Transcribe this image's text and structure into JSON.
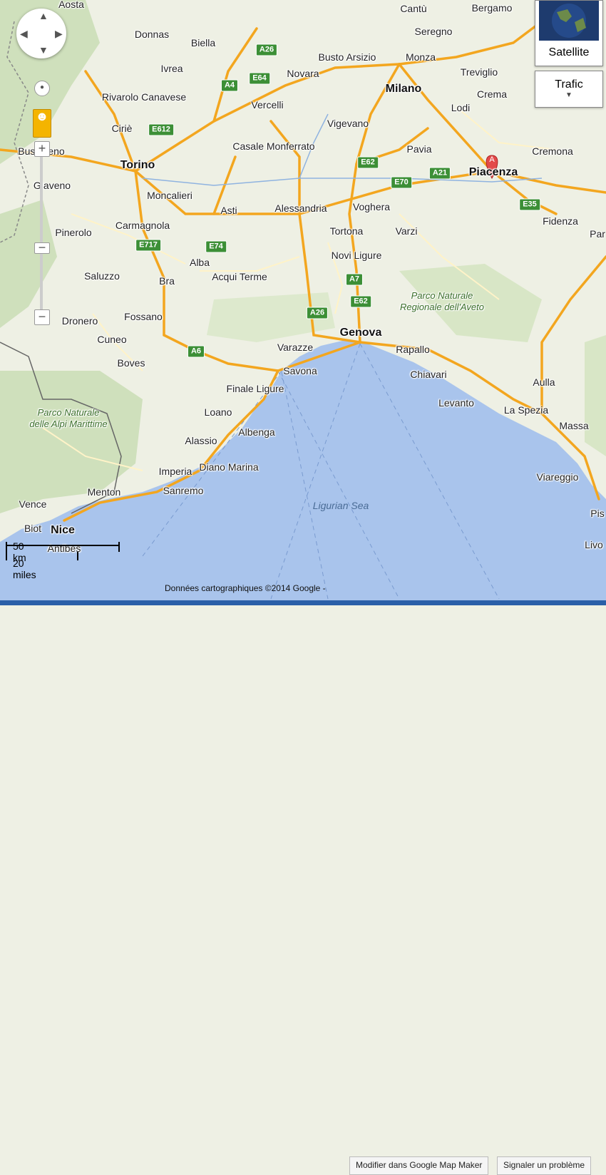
{
  "map_type_controls": {
    "satellite": "Satellite",
    "traffic": "Trafic"
  },
  "attribution": "Données cartographiques ©2014 Google -",
  "footer_links": [
    "Modifier dans Google Map Maker",
    "Signaler un problème"
  ],
  "scale": {
    "km": "50 km",
    "miles": "20 miles"
  },
  "marker": {
    "letter": "A"
  },
  "sea_label": "Ligurian Sea",
  "parks": [
    "Parco Naturale delle Alpi Marittime",
    "Parco Naturale Regionale dell'Aveto"
  ],
  "cities_major": [
    "Torino",
    "Milano",
    "Genova",
    "Nice",
    "Piacenza"
  ],
  "cities": [
    "Aosta",
    "Bergamo",
    "Cantù",
    "Seregno",
    "Donnas",
    "Biella",
    "Busto Arsizio",
    "Monza",
    "Treviglio",
    "Novara",
    "Ivrea",
    "Rivarolo Canavese",
    "Crema",
    "Lodi",
    "Vercelli",
    "Ciriè",
    "Vigevano",
    "Casale Monferrato",
    "Pavia",
    "Cremona",
    "Bussoleno",
    "Giaveno",
    "Moncalieri",
    "Asti",
    "Alessandria",
    "Voghera",
    "Fidenza",
    "Pinerolo",
    "Carmagnola",
    "Tortona",
    "Varzi",
    "Novi Ligure",
    "Alba",
    "Acqui Terme",
    "Saluzzo",
    "Bra",
    "Fossano",
    "Dronero",
    "Cuneo",
    "Boves",
    "Varazze",
    "Savona",
    "Rapallo",
    "Chiavari",
    "Finale Ligure",
    "Loano",
    "Albenga",
    "Alassio",
    "Imperia",
    "Diano Marina",
    "Sanremo",
    "Menton",
    "Levanto",
    "La Spezia",
    "Aulla",
    "Massa",
    "Viareggio",
    "Vence",
    "Biot",
    "Antibes",
    "Pis",
    "Livo",
    "Par"
  ],
  "highways": [
    "A26",
    "E64",
    "A4",
    "E612",
    "E62",
    "E70",
    "A21",
    "E35",
    "E717",
    "E74",
    "A7",
    "E62",
    "A26",
    "A6"
  ]
}
